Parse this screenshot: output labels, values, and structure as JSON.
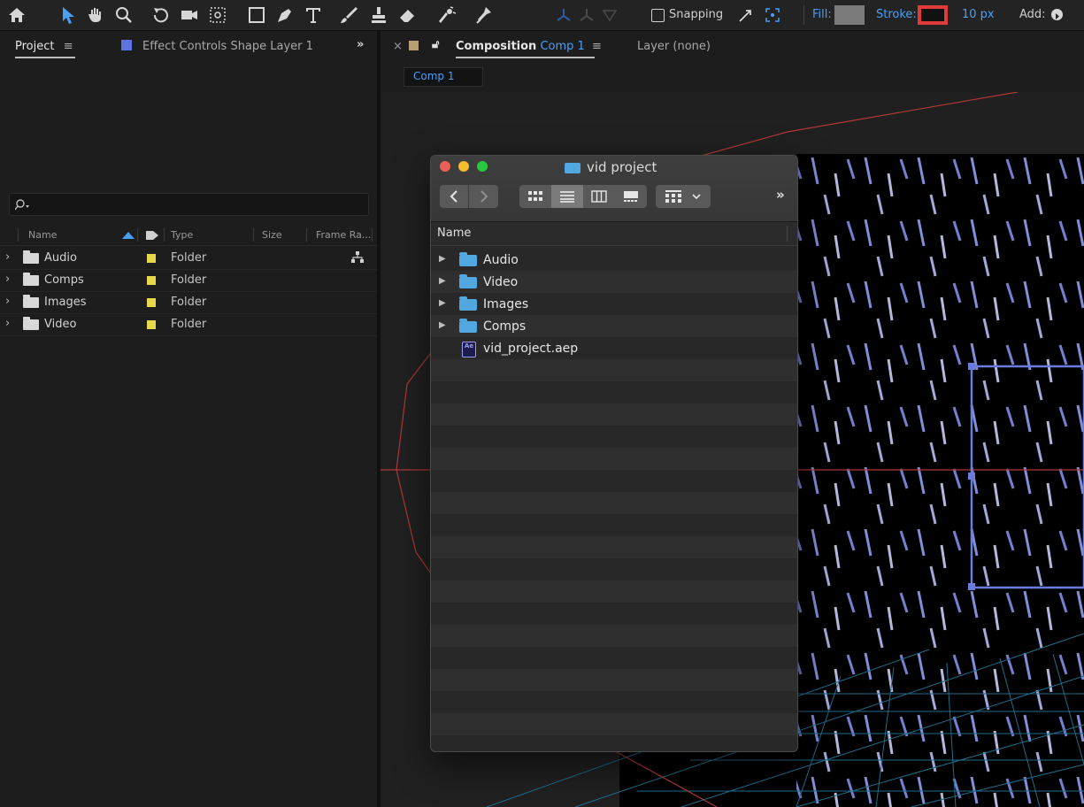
{
  "toolbar": {
    "snapping_label": "Snapping",
    "fill_label": "Fill:",
    "stroke_label": "Stroke:",
    "stroke_width": "10 px",
    "add_label": "Add:",
    "fill_color": "#7b7b7b",
    "stroke_color": "#111111",
    "stroke_border_color": "#e03b3b",
    "accent_color": "#4a9ff5",
    "tools": [
      "home-icon",
      "selection-tool-icon",
      "hand-tool-icon",
      "zoom-tool-icon",
      "rotate-tool-icon",
      "camera-tool-icon",
      "pan-behind-tool-icon",
      "rectangle-tool-icon",
      "pen-tool-icon",
      "type-tool-icon",
      "brush-tool-icon",
      "clone-stamp-tool-icon",
      "eraser-tool-icon",
      "roto-brush-tool-icon",
      "puppet-tool-icon"
    ]
  },
  "project_panel": {
    "tab_label": "Project",
    "effect_controls_label": "Effect Controls Shape Layer 1",
    "search_placeholder": "",
    "columns": {
      "name": "Name",
      "type": "Type",
      "size": "Size",
      "frame_rate": "Frame Ra..."
    },
    "items": [
      {
        "name": "Audio",
        "type": "Folder"
      },
      {
        "name": "Comps",
        "type": "Folder"
      },
      {
        "name": "Images",
        "type": "Folder"
      },
      {
        "name": "Video",
        "type": "Folder"
      }
    ]
  },
  "composition_panel": {
    "tab_prefix": "Composition",
    "comp_name": "Comp 1",
    "layer_label": "Layer (none)",
    "subtab": "Comp 1"
  },
  "finder": {
    "title": "vid project",
    "column_header": "Name",
    "items": [
      {
        "name": "Audio",
        "kind": "folder"
      },
      {
        "name": "Video",
        "kind": "folder"
      },
      {
        "name": "Images",
        "kind": "folder"
      },
      {
        "name": "Comps",
        "kind": "folder"
      },
      {
        "name": "vid_project.aep",
        "kind": "aep-file"
      }
    ],
    "ae_icon_text": "Ae"
  }
}
